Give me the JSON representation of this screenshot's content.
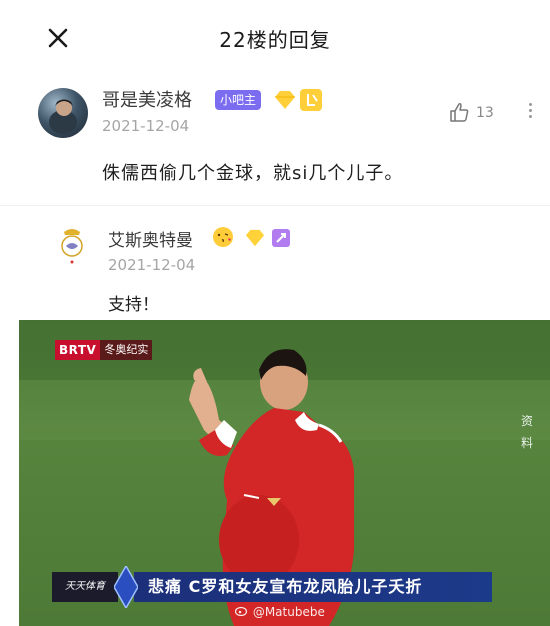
{
  "header": {
    "title": "22楼的回复"
  },
  "main_comment": {
    "username": "哥是美凌格",
    "admin_badge": "小吧主",
    "date": "2021-12-04",
    "text": "侏儒西偷几个金球，就si几个儿子。",
    "like_count": "13"
  },
  "reply": {
    "username": "艾斯奥特曼",
    "date": "2021-12-04",
    "text": "支持！"
  },
  "media": {
    "channel_logo": "BRTV",
    "channel_name": "冬奥纪实",
    "side_label": "资料",
    "caption_logo": "天天体育",
    "caption": "悲痛 C罗和女友宣布龙凤胎儿子夭折",
    "watermark": "@Matubebe"
  },
  "colors": {
    "admin_badge": "#7b6cf0",
    "caption_bg": "#1c3a8a",
    "brtv_red": "#c8102e",
    "jersey_red": "#d32626"
  }
}
